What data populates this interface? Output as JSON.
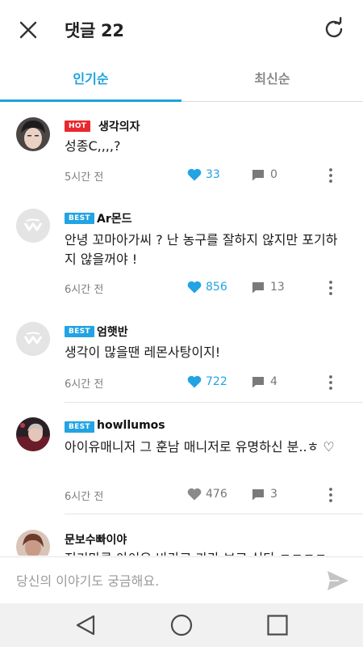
{
  "header": {
    "title": "댓글 22"
  },
  "tabs": [
    {
      "label": "인기순"
    },
    {
      "label": "최신순"
    }
  ],
  "comments": [
    {
      "badge": "HOT",
      "username": "생각의자",
      "content": "성종C,,,,?",
      "time": "5시간 전",
      "likes": "33",
      "replies": "0",
      "liked": true
    },
    {
      "badge": "BEST",
      "username": "Ar몬드",
      "content": "안녕 꼬마아가씨 ? 난 농구를 잘하지 않지만 포기하지 않을꺼야 !",
      "time": "6시간 전",
      "likes": "856",
      "replies": "13",
      "liked": true
    },
    {
      "badge": "BEST",
      "username": "엄햇반",
      "content": "생각이 많을땐 레몬사탕이지!",
      "time": "6시간 전",
      "likes": "722",
      "replies": "4",
      "liked": true
    },
    {
      "badge": "BEST",
      "username": "howllumos",
      "content": "아이유매니저 그 훈남 매니저로 유명하신 분..ㅎ ♡",
      "time": "6시간 전",
      "likes": "476",
      "replies": "3",
      "liked": false
    },
    {
      "badge": "",
      "username": "문보수빠이야",
      "content": "저기만큼 아이유 바라고 가라 보고 싶다 ㅋㅋㅋㅋ",
      "time": "",
      "likes": "",
      "replies": "",
      "liked": false
    }
  ],
  "input": {
    "placeholder": "당신의 이야기도 궁금해요."
  },
  "colors": {
    "accent": "#1ea2de",
    "hot": "#e8292e",
    "best": "#22a3e3"
  },
  "icons": {
    "close": "close-icon",
    "refresh": "refresh-icon",
    "like": "heart-icon",
    "reply": "comment-bubble-icon",
    "more": "more-vertical-icon",
    "send": "send-icon",
    "back": "nav-back-icon",
    "home": "nav-home-icon",
    "recents": "nav-recents-icon"
  }
}
